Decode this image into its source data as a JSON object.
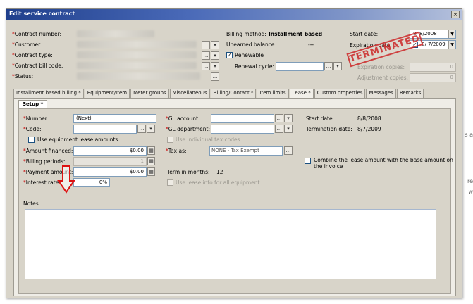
{
  "window": {
    "title": "Edit service contract",
    "close_glyph": "×"
  },
  "background_text": [
    "s a",
    "re",
    "w"
  ],
  "header": {
    "labels": {
      "contract_number": "Contract number:",
      "customer": "Customer:",
      "contract_type": "Contract type:",
      "contract_bill_code": "Contract bill code:",
      "status": "Status:"
    },
    "billing_method_label": "Billing method:",
    "billing_method_value": "Installment based",
    "unearned_balance_label": "Unearned balance:",
    "unearned_balance_value": "---",
    "renewable_label": "Renewable",
    "renewal_cycle_label": "Renewal cycle:",
    "start_date_label": "Start date:",
    "start_date_value": "8/ 8/2008",
    "expiration_date_label": "Expiration date:",
    "expiration_date_value": "8/ 7/2009",
    "expiration_copies_label": "Expiration copies:",
    "expiration_copies_value": "0",
    "adjustment_copies_label": "Adjustment copies:",
    "adjustment_copies_value": "0",
    "stamp_text": "TERMINATED"
  },
  "tabs": [
    "Installment based billing *",
    "Equipment/Item",
    "Meter groups",
    "Miscellaneous",
    "Billing/Contact *",
    "Item limits",
    "Lease *",
    "Custom properties",
    "Messages",
    "Remarks"
  ],
  "setup": {
    "tab_label": "Setup *",
    "number_label": "Number:",
    "number_value": "(Next)",
    "code_label": "Code:",
    "use_equipment_lease_label": "Use equipment lease amounts",
    "amount_financed_label": "Amount financed:",
    "amount_financed_value": "$0.00",
    "billing_periods_label": "Billing periods:",
    "billing_periods_value": "1",
    "payment_amount_label": "Payment amount:",
    "payment_amount_value": "$0.00",
    "interest_rate_label": "Interest rate:",
    "interest_rate_value": "0%",
    "gl_account_label": "GL account:",
    "gl_department_label": "GL department:",
    "use_individual_tax_label": "Use individual tax codes",
    "tax_as_label": "Tax as:",
    "tax_as_value": "NONE - Tax Exempt",
    "term_in_months_label": "Term in months:",
    "term_in_months_value": "12",
    "use_lease_info_label": "Use lease info for all equipment",
    "start_date_label": "Start date:",
    "start_date_value": "8/8/2008",
    "termination_date_label": "Termination date:",
    "termination_date_value": "8/7/2009",
    "combine_label_1": "Combine the lease amount with the base amount on",
    "combine_label_2": "the invoice",
    "notes_label": "Notes:",
    "notes_value": ""
  },
  "colors": {
    "required": "#cc0000",
    "stamp": "#cc2222",
    "arrow": "#dd1111",
    "titlebar": "#1f3f8c"
  }
}
